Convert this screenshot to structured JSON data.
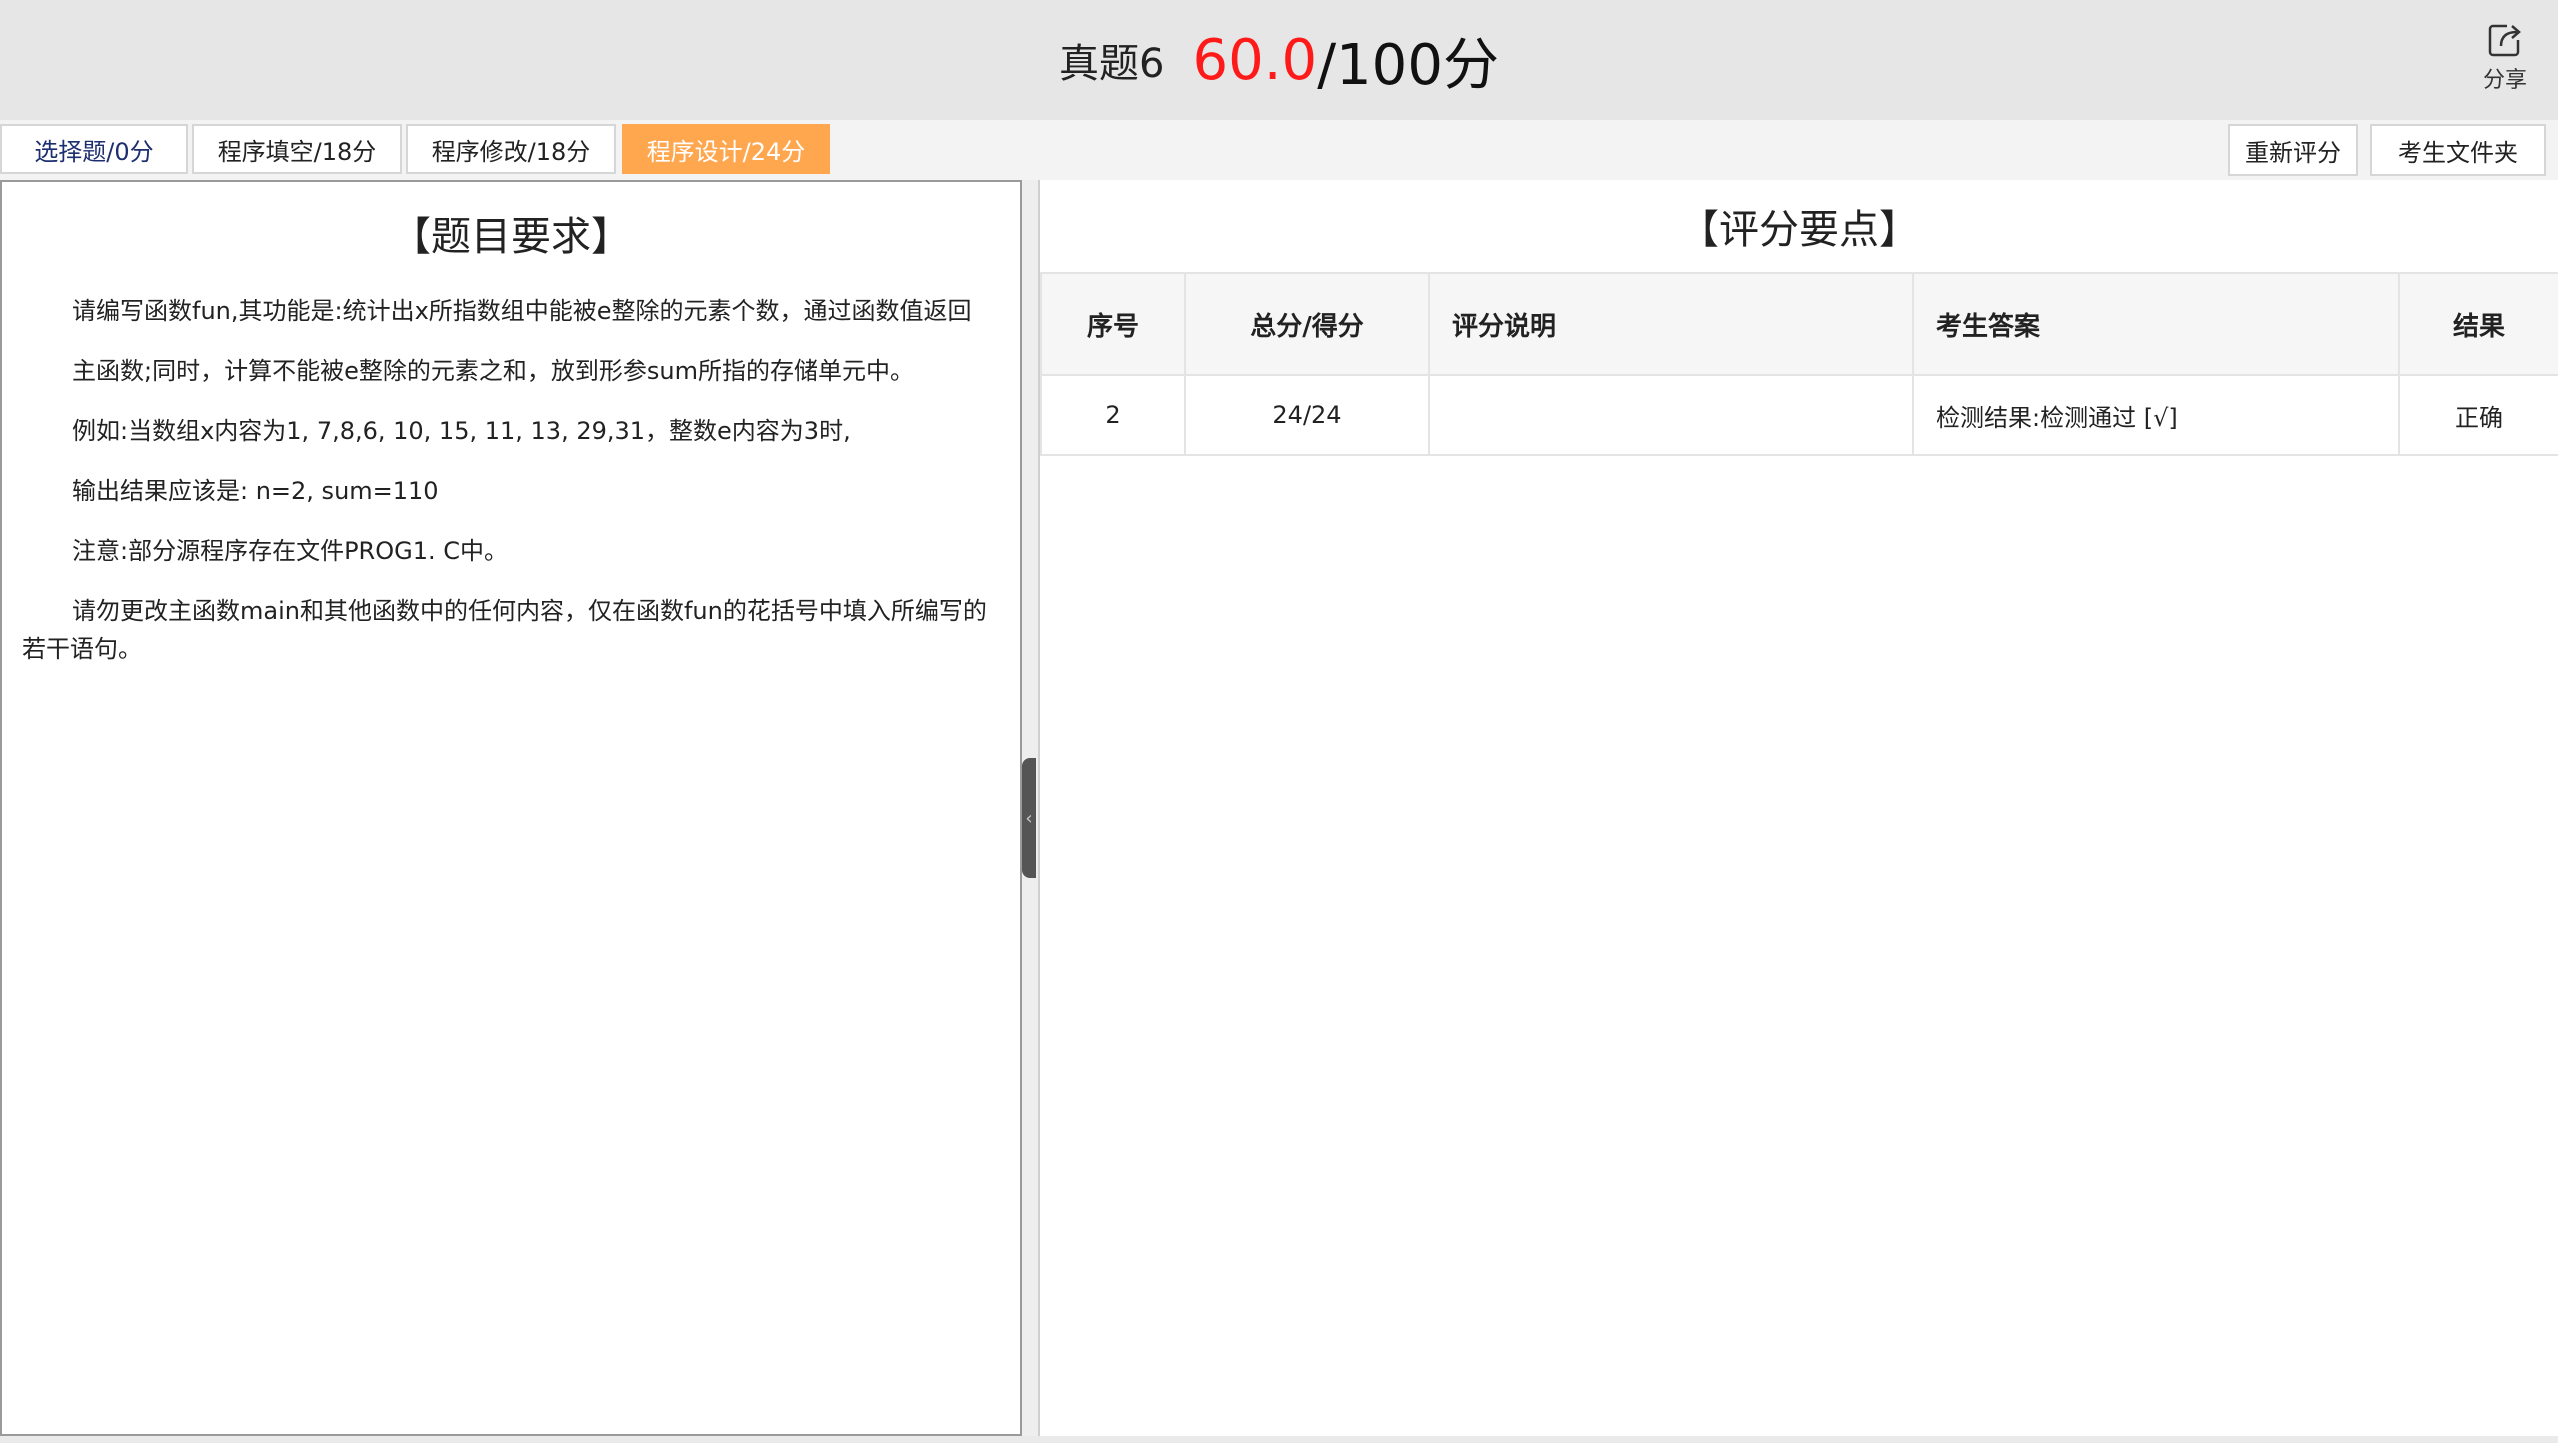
{
  "header": {
    "title": "真题6",
    "score_current": "60.0",
    "score_total": "/100分",
    "share_label": "分享"
  },
  "tabs": [
    {
      "label": "选择题/0分"
    },
    {
      "label": "程序填空/18分"
    },
    {
      "label": "程序修改/18分"
    },
    {
      "label": "程序设计/24分"
    }
  ],
  "actions": {
    "regrade_label": "重新评分",
    "folder_label": "考生文件夹"
  },
  "left": {
    "title": "【题目要求】",
    "paragraphs": [
      "请编写函数fun,其功能是:统计出x所指数组中能被e整除的元素个数，通过函数值返回",
      "主函数;同时，计算不能被e整除的元素之和，放到形参sum所指的存储单元中。",
      "例如:当数组x内容为1, 7,8,6, 10, 15, 11, 13, 29,31，整数e内容为3时,",
      "输出结果应该是: n=2, sum=110",
      "注意:部分源程序存在文件PROG1. C中。",
      "请勿更改主函数main和其他函数中的任何内容，仅在函数fun的花括号中填入所编写的若干语句。"
    ]
  },
  "right": {
    "title": "【评分要点】",
    "columns": [
      "序号",
      "总分/得分",
      "评分说明",
      "考生答案",
      "结果"
    ],
    "rows": [
      {
        "index": "2",
        "score": "24/24",
        "note": "",
        "answer": "检测结果:检测通过 [√]",
        "result": "正确"
      }
    ]
  },
  "icons": {
    "share": "share-icon",
    "collapse": "chevron-left-icon"
  },
  "colors": {
    "score_red": "#ff1a1a",
    "active_tab": "#ffa74f"
  }
}
